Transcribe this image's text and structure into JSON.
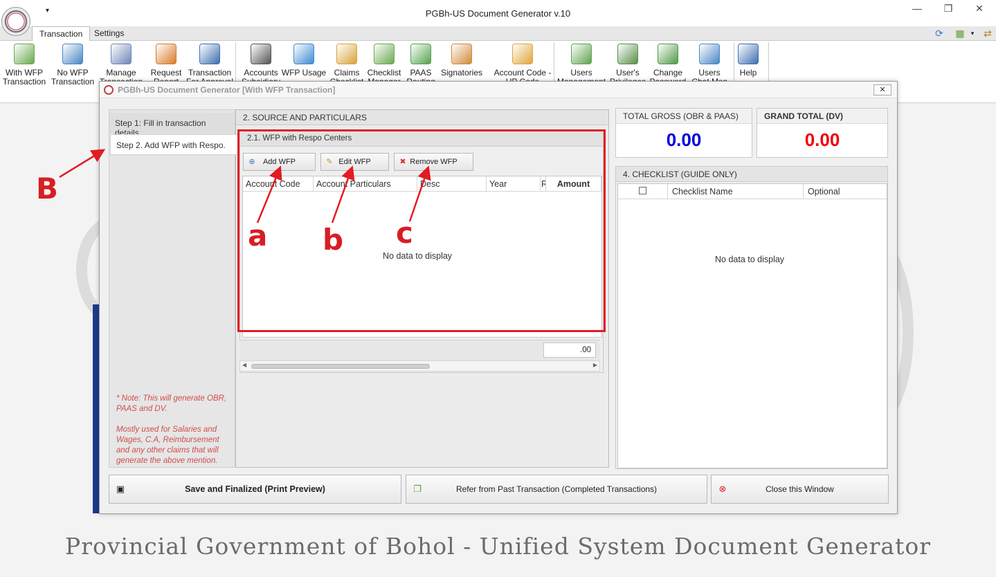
{
  "app": {
    "title": "PGBh-US Document Generator v.10",
    "min": "—",
    "max": "❐",
    "close": "✕",
    "qa_arrow": "▾"
  },
  "tabs": [
    {
      "label": "Transaction",
      "active": true
    },
    {
      "label": "Settings",
      "active": false
    }
  ],
  "ribbon": {
    "buttons": [
      {
        "label": "With WFP\nTransaction",
        "icon": "doc-add-green-icon",
        "color": "#6aa84f"
      },
      {
        "label": "No WFP\nTransaction",
        "icon": "doc-add-blue-icon",
        "color": "#4a86c5"
      },
      {
        "label": "Manage\nTransaction",
        "icon": "list-icon",
        "color": "#6d86b8"
      },
      {
        "label": "Request\nReport",
        "icon": "user-arrow-icon",
        "color": "#d97a2b"
      },
      {
        "label": "Transaction\nFor Approval",
        "icon": "ab-icon",
        "color": "#3c6fb0"
      },
      {
        "label": "Accounts\nSubsidiary",
        "icon": "book-icon",
        "color": "#555555"
      },
      {
        "label": "WFP Usage",
        "icon": "magnifier-icon",
        "color": "#3d8bd1"
      },
      {
        "label": "Claims\nChecklist",
        "icon": "clipboard-icon",
        "color": "#d8a33b"
      },
      {
        "label": "Checklist\nManager",
        "icon": "checklist-icon",
        "color": "#6aa84f"
      },
      {
        "label": "PAAS\nRouting",
        "icon": "refresh-icon",
        "color": "#54a24e"
      },
      {
        "label": "Signatories",
        "icon": "users-group-icon",
        "color": "#d08a3a"
      },
      {
        "label": "Account Code -\nUP Code Tracking",
        "icon": "tag-icon",
        "color": "#e0a53a"
      },
      {
        "label": "Users\nManagement",
        "icon": "users-icon",
        "color": "#5fa24e"
      },
      {
        "label": "User's\nPrivileges",
        "icon": "user-gear-icon",
        "color": "#5a8f4a"
      },
      {
        "label": "Change\nPassword",
        "icon": "user-refresh-icon",
        "color": "#4f9a48"
      },
      {
        "label": "Users\nChat Msg",
        "icon": "chat-icon",
        "color": "#4a86c5"
      },
      {
        "label": "Help",
        "icon": "help-icon",
        "color": "#3c6fb0"
      }
    ]
  },
  "dialog": {
    "title": "PGBh-US Document Generator [With WFP Transaction]",
    "close": "✕",
    "steps": [
      "Step 1: Fill in transaction details.",
      "Step 2. Add WFP with Respo."
    ],
    "note": "* Note: This will generate OBR, PAAS and DV.\n\nMostly used for Salaries and Wages, C.A, Reimbursement and any other claims that will generate the above mention.",
    "source_header": "2. SOURCE AND PARTICULARS",
    "wfp_header": "2.1. WFP with Respo Centers",
    "buttons": {
      "add": "Add WFP",
      "edit": "Edit WFP",
      "remove": "Remove WFP"
    },
    "grid_columns": [
      "Account Code",
      "Account Particulars",
      "Desc",
      "Year",
      "R",
      "Amount"
    ],
    "grid_empty": "No data to display",
    "grid_sum": ".00",
    "total_gross": {
      "label": "TOTAL GROSS (OBR & PAAS)",
      "value": "0.00",
      "color": "#0000e0"
    },
    "grand_total": {
      "label": "GRAND TOTAL (DV)",
      "value": "0.00",
      "color": "#f00000"
    },
    "checklist": {
      "header": "4. CHECKLIST (GUIDE ONLY)",
      "columns": [
        "Checklist Name",
        "Optional"
      ],
      "empty": "No data to display"
    },
    "bottom": {
      "save": "Save and Finalized (Print Preview)",
      "refer": "Refer from Past Transaction (Completed Transactions)",
      "close": "Close this Window"
    }
  },
  "annotations": {
    "big": "B",
    "a": "a",
    "b": "b",
    "c": "c"
  },
  "footer": "Provincial Government of Bohol - Unified System Document Generator"
}
